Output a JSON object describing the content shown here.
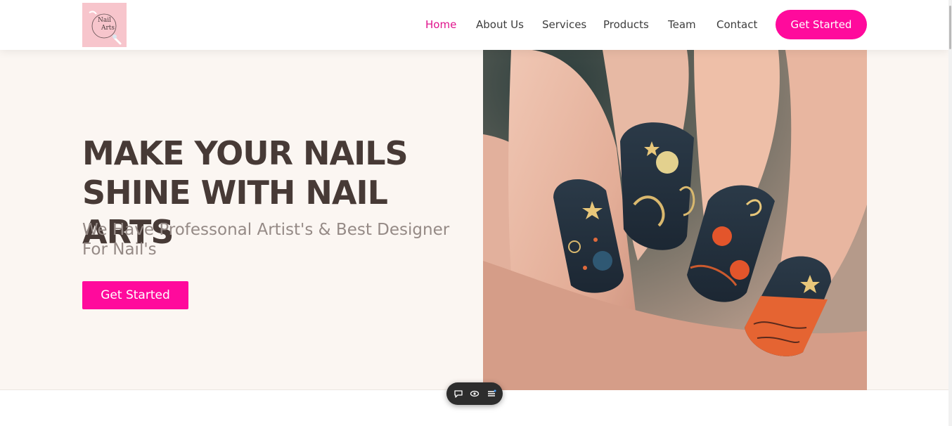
{
  "header": {
    "logo_text_line1": "Nail",
    "logo_text_line2": "Arts",
    "nav": {
      "home": "Home",
      "about": "About Us",
      "services": "Services",
      "products": "Products",
      "team": "Team",
      "contact": "Contact"
    },
    "cta_label": "Get Started"
  },
  "hero": {
    "title_line1": "MAKE YOUR NAILS",
    "title_line2": "SHINE WITH NAIL ARTS",
    "subtitle": "We Have Professonal Artist's & Best Designer For Nail's",
    "cta_label": "Get Started",
    "image_icon": "manicured-hand-image"
  },
  "widget": {
    "icons": [
      "chat-icon",
      "eye-icon",
      "menu-icon"
    ]
  },
  "colors": {
    "accent": "#ff0a9c",
    "nav_active": "#e0138c",
    "hero_bg": "#fbf6f2",
    "title": "#473a36",
    "subtitle": "#958a86"
  }
}
